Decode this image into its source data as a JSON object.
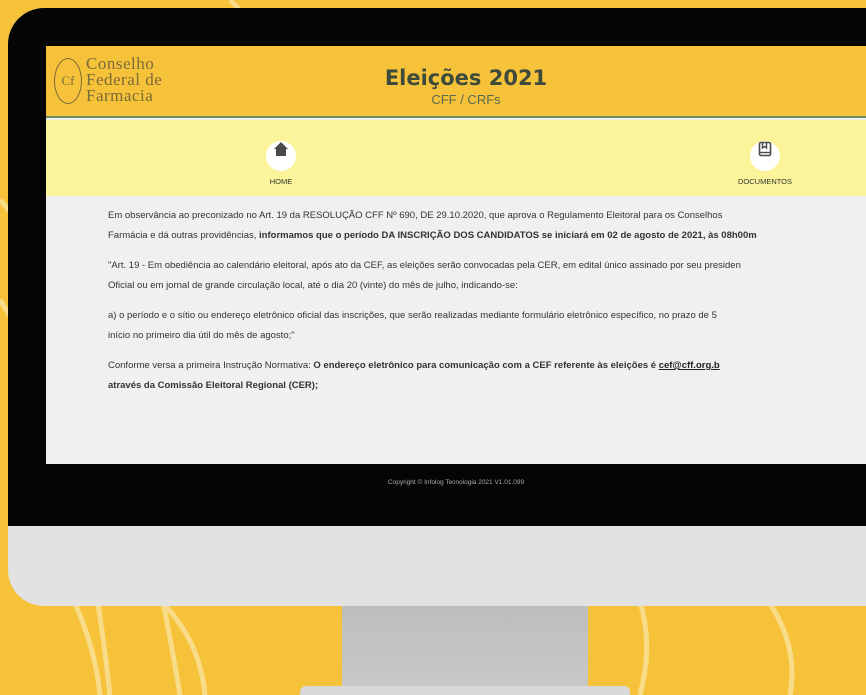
{
  "colors": {
    "background": "#f6c23a",
    "header": "#f6c23a",
    "navbar": "#fbf49a",
    "screen_bg": "#f0f0f0"
  },
  "logo": {
    "line1": "Conselho",
    "line2": "Federal de",
    "line3": "Farmacia",
    "emblem": "Cf"
  },
  "header": {
    "title": "Eleições 2021",
    "subtitle": "CFF / CRFs"
  },
  "nav": {
    "home": {
      "label": "HOME",
      "icon": "home-icon"
    },
    "documents": {
      "label": "DOCUMENTOS",
      "icon": "book-icon"
    }
  },
  "content": {
    "p1_l1": "Em observância ao preconizado no Art. 19 da RESOLUÇÃO CFF Nº 690, DE 29.10.2020, que aprova o Regulamento Eleitoral para os Conselhos",
    "p1_l2_a": "Farmácia e dá outras providências, ",
    "p1_l2_b": "informamos que o período DA INSCRIÇÃO DOS CANDIDATOS se iniciará em 02 de agosto de 2021, às 08h00m",
    "p2_l1": "\"Art. 19 - Em obediência ao calendário eleitoral, após ato da CEF, as eleições serão convocadas pela CER, em edital único assinado por seu presiden",
    "p2_l2": "Oficial ou em jornal de grande circulação local, até o dia 20 (vinte) do mês de julho, indicando-se:",
    "p3_l1": "a) o período e o sítio ou endereço eletrônico oficial das inscrições, que serão realizadas mediante formulário eletrônico específico, no prazo de 5",
    "p3_l2": "início no primeiro dia útil do mês de agosto;\"",
    "p4_l1_a": "Conforme versa a primeira Instrução Normativa: ",
    "p4_l1_b": "O endereço eletrônico para comunicação com a CEF referente às eleições é ",
    "p4_l1_link": "cef@cff.org.b",
    "p4_l2": "através da Comissão Eleitoral Regional (CER);"
  },
  "footer": {
    "copyright": "Copyright © Infolog Tecnologia 2021 V1.01.099"
  }
}
